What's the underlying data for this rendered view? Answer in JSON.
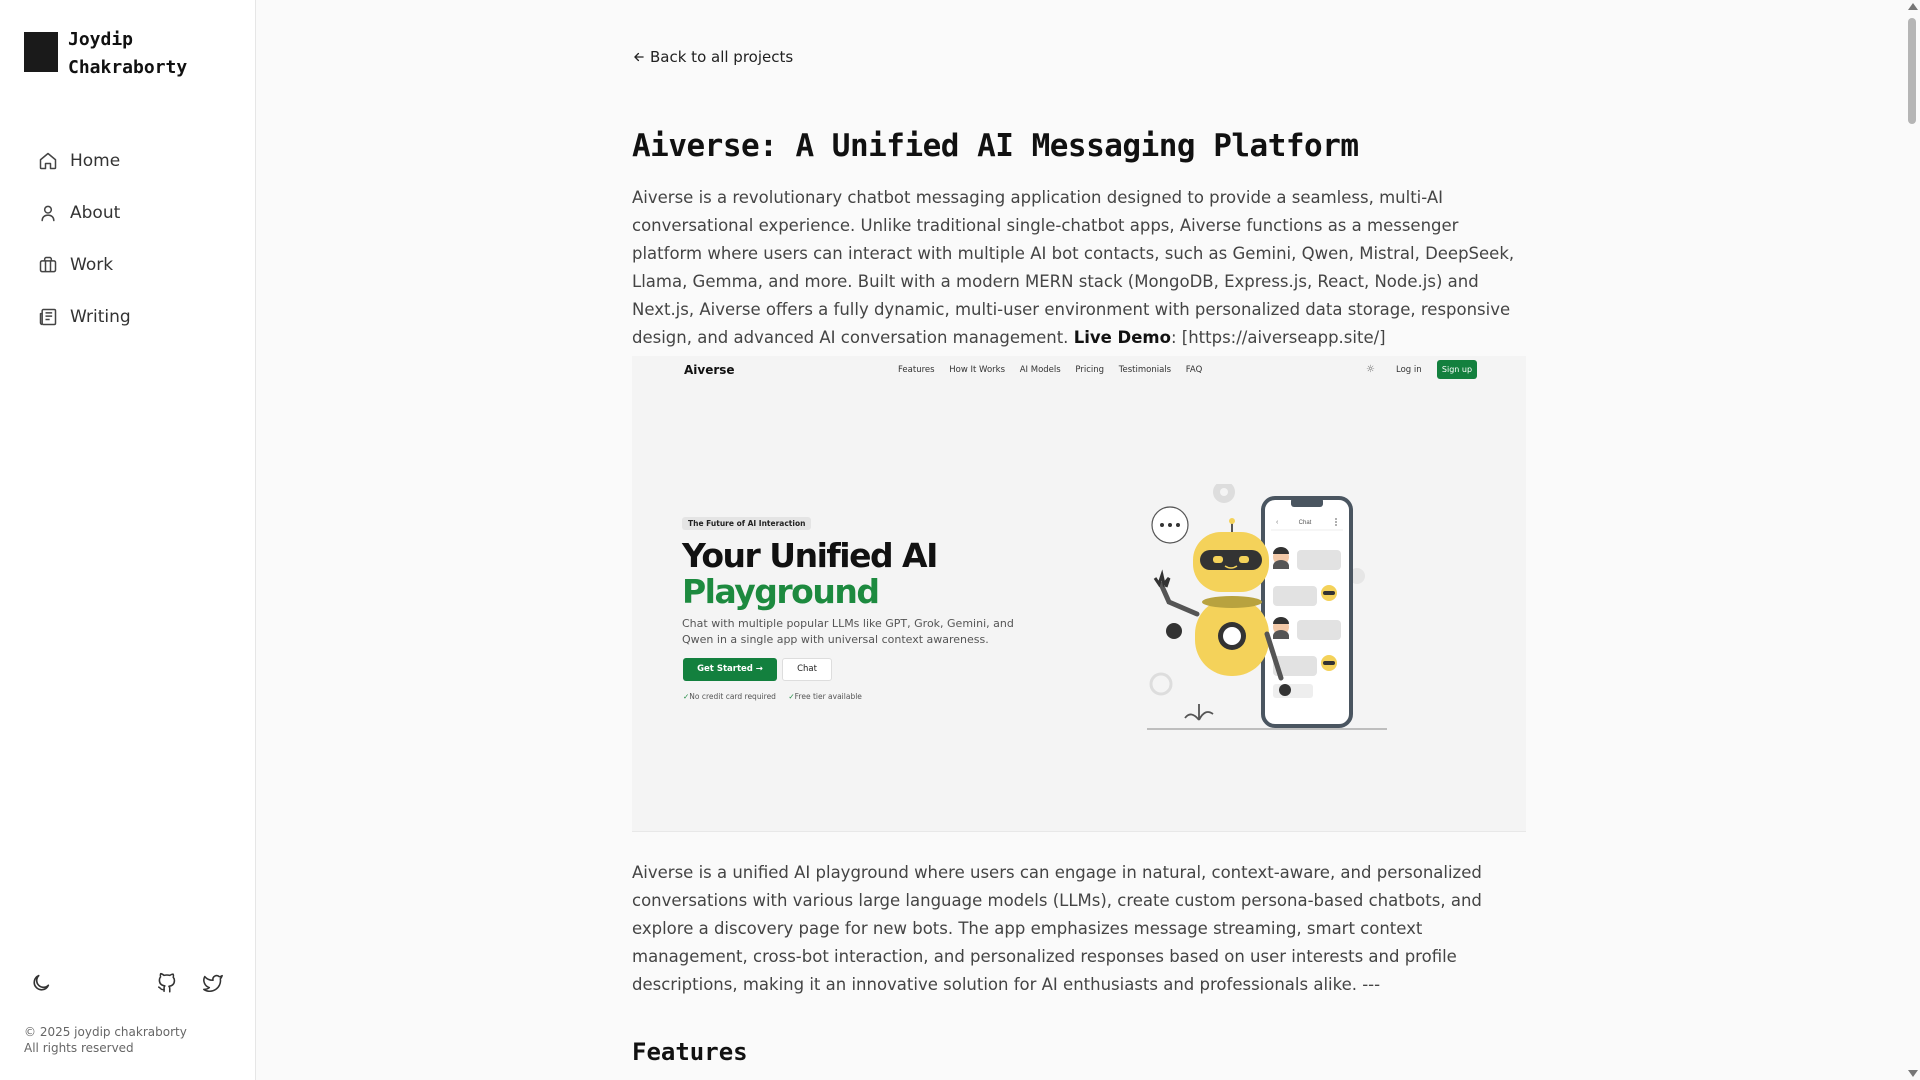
{
  "sidebar": {
    "brand_line1": "Joydip",
    "brand_line2": "Chakraborty",
    "items": [
      {
        "label": "Home",
        "icon": "home-icon"
      },
      {
        "label": "About",
        "icon": "user-icon"
      },
      {
        "label": "Work",
        "icon": "briefcase-icon"
      },
      {
        "label": "Writing",
        "icon": "newspaper-icon"
      }
    ],
    "icons": [
      "moon-icon",
      "github-icon",
      "twitter-icon"
    ],
    "copyright_line1": "© 2025 joydip chakraborty",
    "copyright_line2": "All rights reserved"
  },
  "main": {
    "back_link": "Back to all projects",
    "title": "Aiverse: A Unified AI Messaging Platform",
    "intro": "Aiverse is a revolutionary chatbot messaging application designed to provide a seamless, multi-AI conversational experience. Unlike traditional single-chatbot apps, Aiverse functions as a messenger platform where users can interact with multiple AI bot contacts, such as Gemini, Qwen, Mistral, DeepSeek, Llama, Gemma, and more. Built with a modern MERN stack (MongoDB, Express.js, React, Node.js) and Next.js, Aiverse offers a fully dynamic, multi-user environment with personalized data storage, responsive design, and advanced AI conversation management. ",
    "live_demo_label": "Live Demo",
    "live_demo_text": ": [https://aiverseapp.site/](https://aiverseapp.site/)",
    "hero": {
      "logo": "Aiverse",
      "links": [
        "Features",
        "How It Works",
        "AI Models",
        "Pricing",
        "Testimonials",
        "FAQ"
      ],
      "login": "Log in",
      "signup": "Sign up",
      "badge": "The Future of AI Interaction",
      "headline1": "Your Unified AI",
      "headline2": "Playground",
      "subtext": "Chat with multiple popular LLMs like GPT, Grok, Gemini, and Qwen in a single app with universal context awareness.",
      "cta_primary": "Get Started →",
      "cta_secondary": "Chat",
      "check1": "No credit card required",
      "check2": "Free tier available",
      "phone_header": "Chat",
      "accent_color": "#13803e"
    },
    "summary": "Aiverse is a unified AI playground where users can engage in natural, context-aware, and personalized conversations with various large language models (LLMs), create custom persona-based chatbots, and explore a discovery page for new bots. The app emphasizes message streaming, smart context management, cross-bot interaction, and personalized responses based on user interests and profile descriptions, making it an innovative solution for AI enthusiasts and professionals alike. ---",
    "features_heading": "Features"
  }
}
